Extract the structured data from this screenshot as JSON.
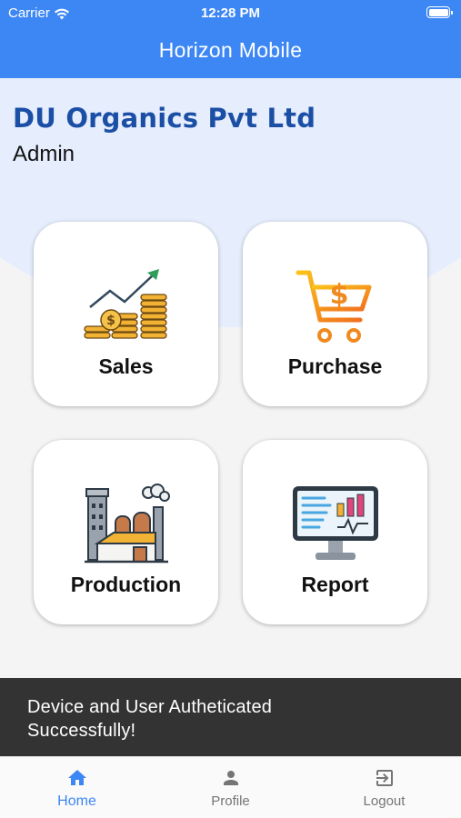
{
  "status_bar": {
    "carrier": "Carrier",
    "time": "12:28 PM"
  },
  "app_bar": {
    "title": "Horizon Mobile"
  },
  "company": {
    "name": "DU Organics Pvt Ltd",
    "role": "Admin"
  },
  "tiles": [
    {
      "label": "Sales",
      "icon": "sales-chart-coins-icon"
    },
    {
      "label": "Purchase",
      "icon": "shopping-cart-dollar-icon"
    },
    {
      "label": "Production",
      "icon": "factory-icon"
    },
    {
      "label": "Report",
      "icon": "monitor-report-icon"
    }
  ],
  "snackbar": {
    "line1": "Device and User Autheticated",
    "line2": "Successfully!"
  },
  "bottom_nav": [
    {
      "label": "Home",
      "icon": "home-icon",
      "active": true
    },
    {
      "label": "Profile",
      "icon": "person-icon",
      "active": false
    },
    {
      "label": "Logout",
      "icon": "logout-icon",
      "active": false
    }
  ],
  "colors": {
    "primary": "#3d87f5",
    "company": "#1b4fa6",
    "snackbar": "#333333",
    "background": "#f4f4f5"
  }
}
